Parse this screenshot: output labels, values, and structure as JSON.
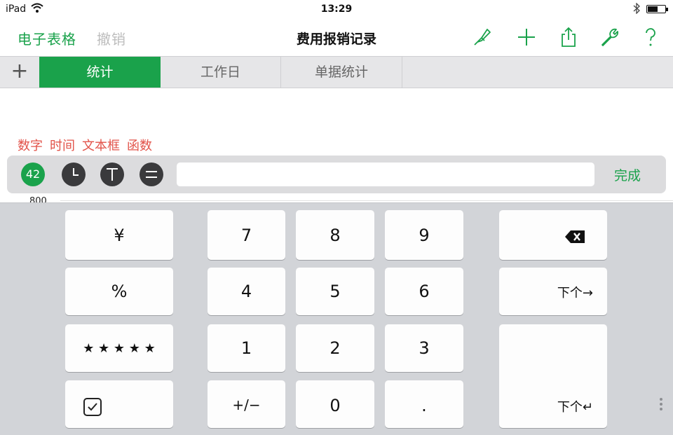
{
  "status_bar": {
    "carrier": "iPad",
    "time": "13:29"
  },
  "nav": {
    "back_label": "电子表格",
    "undo_label": "撤销",
    "title": "费用报销记录",
    "icons": [
      "paintbrush-icon",
      "plus-icon",
      "share-icon",
      "wrench-icon",
      "help-icon"
    ]
  },
  "tabs": {
    "add_label": "+",
    "items": [
      {
        "label": "统计",
        "active": true
      },
      {
        "label": "工作日",
        "active": false
      },
      {
        "label": "单据统计",
        "active": false
      }
    ]
  },
  "format_labels": [
    "数字",
    "时间",
    "文本框",
    "函数"
  ],
  "formula_bar": {
    "number_button_label": "42",
    "input_value": "",
    "done_label": "完成"
  },
  "chart_peek": {
    "axis_label": "800"
  },
  "keyboard": {
    "left_column": [
      "¥",
      "%",
      "★ ★ ★ ★ ★",
      "checkbox"
    ],
    "digits_row1": [
      "7",
      "8",
      "9"
    ],
    "digits_row2": [
      "4",
      "5",
      "6"
    ],
    "digits_row3": [
      "1",
      "2",
      "3"
    ],
    "bottom_row": [
      "+/−",
      "0",
      "."
    ],
    "next_right_label": "下个→",
    "next_enter_label": "下个↵"
  },
  "colors": {
    "accent_green": "#1aa24b",
    "label_red": "#e2534a",
    "disabled_gray": "#bdbdbd"
  }
}
